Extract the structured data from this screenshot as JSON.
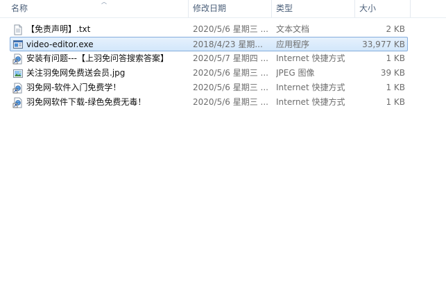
{
  "columns": {
    "name": "名称",
    "date": "修改日期",
    "type": "类型",
    "size": "大小"
  },
  "files": [
    {
      "name": "【免责声明】.txt",
      "date": "2020/5/6 星期三 ...",
      "type": "文本文档",
      "size": "2 KB",
      "icon": "text-file-icon",
      "selected": false
    },
    {
      "name": "video-editor.exe",
      "date": "2018/4/23 星期...",
      "type": "应用程序",
      "size": "33,977 KB",
      "icon": "exe-file-icon",
      "selected": true
    },
    {
      "name": "安装有问题---【上羽免问答搜索答案】",
      "date": "2020/5/7 星期四 ...",
      "type": "Internet 快捷方式",
      "size": "1 KB",
      "icon": "internet-shortcut-icon",
      "selected": false
    },
    {
      "name": "关注羽免网免费送会员.jpg",
      "date": "2020/5/6 星期三 ...",
      "type": "JPEG 图像",
      "size": "39 KB",
      "icon": "image-file-icon",
      "selected": false
    },
    {
      "name": "羽免网-软件入门免费学！",
      "date": "2020/5/6 星期三 ...",
      "type": "Internet 快捷方式",
      "size": "1 KB",
      "icon": "internet-shortcut-icon",
      "selected": false
    },
    {
      "name": "羽免网软件下载-绿色免费无毒！",
      "date": "2020/5/6 星期三 ...",
      "type": "Internet 快捷方式",
      "size": "1 KB",
      "icon": "internet-shortcut-icon",
      "selected": false
    }
  ],
  "colors": {
    "header_text": "#4c607a",
    "selection_border": "#84acdd",
    "selection_fill": "#dcecfc",
    "secondary_text": "#6d6d6d"
  }
}
